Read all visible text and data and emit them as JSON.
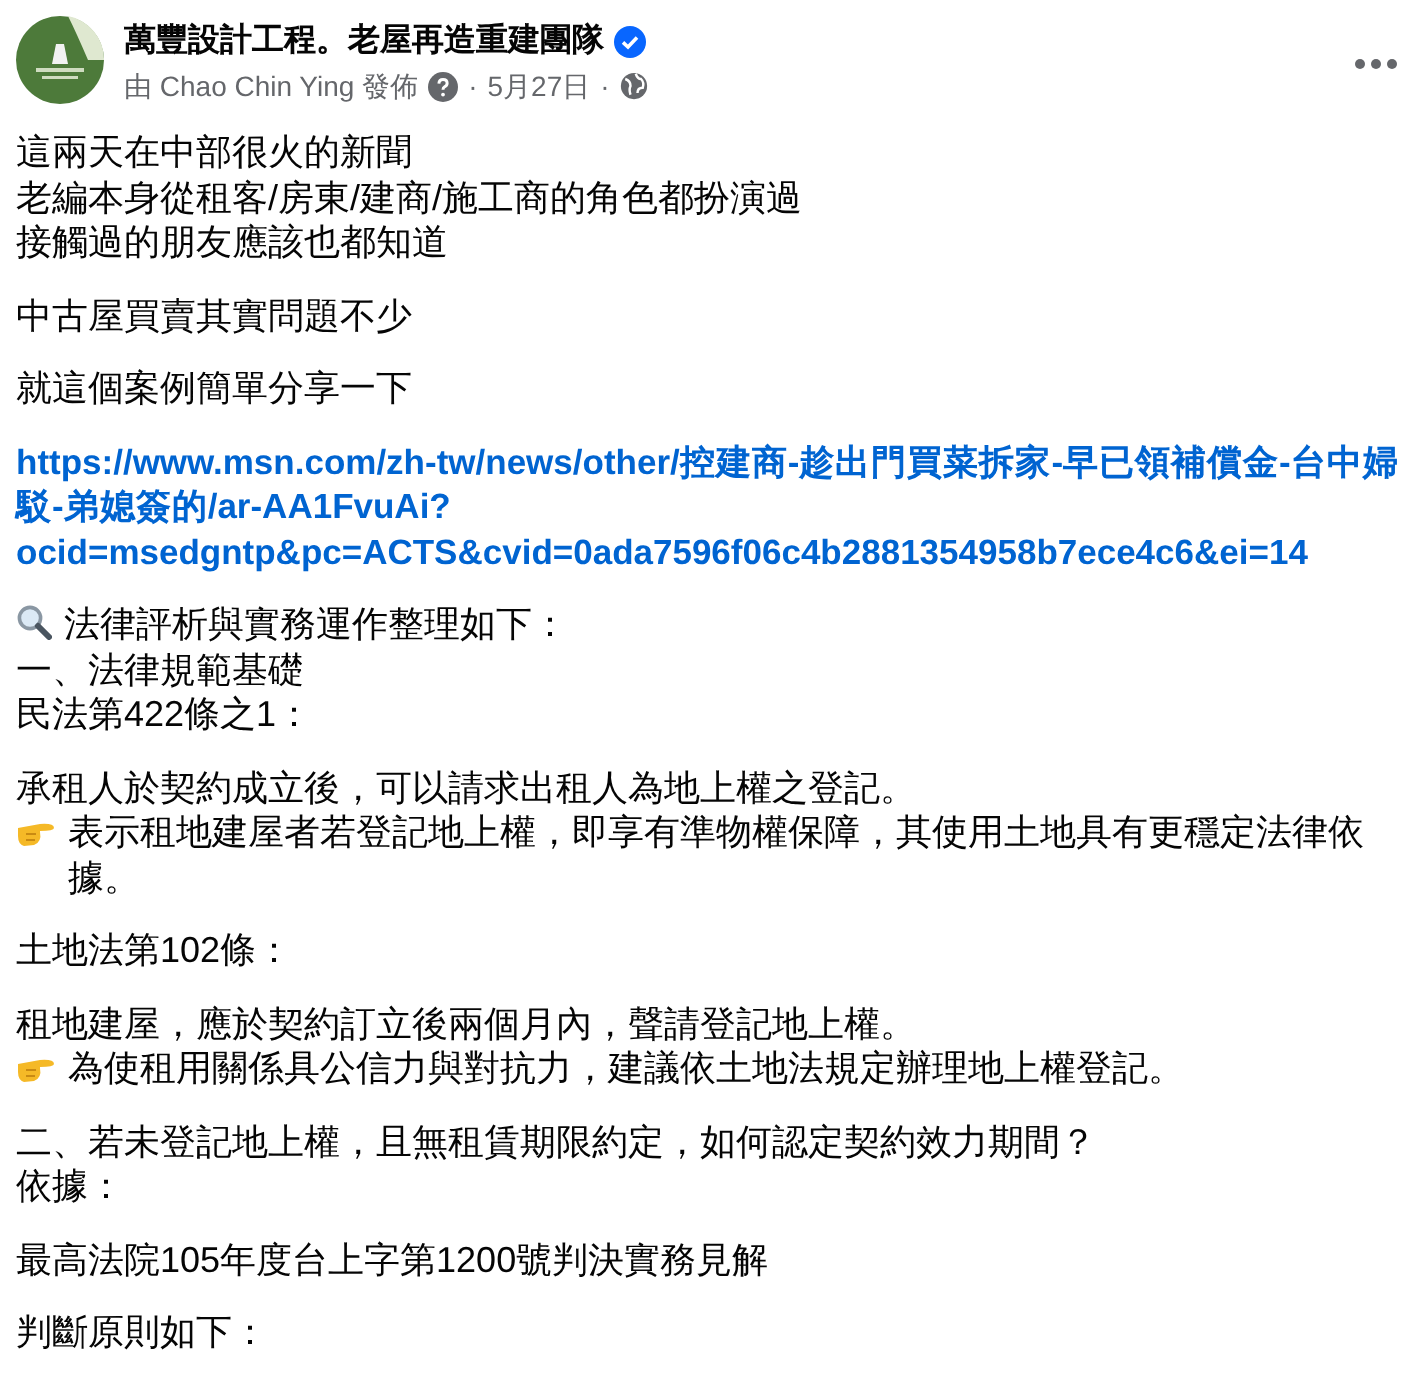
{
  "post": {
    "page_name": "萬豐設計工程。老屋再造重建團隊",
    "verified": true,
    "byline": "由 Chao Chin Ying 發佈",
    "date": "5月27日",
    "separator": "·"
  },
  "paragraphs": [
    {
      "lines": [
        {
          "kind": "text",
          "text": "這兩天在中部很火的新聞"
        },
        {
          "kind": "text",
          "text": "老編本身從租客/房東/建商/施工商的角色都扮演過"
        },
        {
          "kind": "text",
          "text": "接觸過的朋友應該也都知道"
        }
      ]
    },
    {
      "lines": [
        {
          "kind": "text",
          "text": "中古屋買賣其實問題不少"
        }
      ]
    },
    {
      "lines": [
        {
          "kind": "text",
          "text": "就這個案例簡單分享一下"
        }
      ]
    },
    {
      "lines": [
        {
          "kind": "link",
          "text": "https://www.msn.com/zh-tw/news/other/控建商-趁出門買菜拆家-早已領補償金-台中婦駁-弟媳簽的/ar-AA1FvuAi?ocid=msedgntp&pc=ACTS&cvid=0ada7596f06c4b2881354958b7ece4c6&ei=14"
        }
      ]
    },
    {
      "lines": [
        {
          "kind": "search",
          "text": "法律評析與實務運作整理如下："
        },
        {
          "kind": "text",
          "text": "一、法律規範基礎"
        },
        {
          "kind": "text",
          "text": "民法第422條之1："
        }
      ]
    },
    {
      "lines": [
        {
          "kind": "text",
          "text": "承租人於契約成立後，可以請求出租人為地上權之登記。"
        },
        {
          "kind": "point",
          "text": "表示租地建屋者若登記地上權，即享有準物權保障，其使用土地具有更穩定法律依據。"
        }
      ]
    },
    {
      "lines": [
        {
          "kind": "text",
          "text": "土地法第102條："
        }
      ]
    },
    {
      "lines": [
        {
          "kind": "text",
          "text": "租地建屋，應於契約訂立後兩個月內，聲請登記地上權。"
        },
        {
          "kind": "point",
          "text": "為使租用關係具公信力與對抗力，建議依土地法規定辦理地上權登記。"
        }
      ]
    },
    {
      "lines": [
        {
          "kind": "text",
          "text": "二、若未登記地上權，且無租賃期限約定，如何認定契約效力期間？"
        },
        {
          "kind": "text",
          "text": "依據："
        }
      ]
    },
    {
      "lines": [
        {
          "kind": "text",
          "text": "最高法院105年度台上字第1200號判決實務見解"
        }
      ]
    },
    {
      "lines": [
        {
          "kind": "text",
          "text": "判斷原則如下："
        }
      ]
    }
  ]
}
